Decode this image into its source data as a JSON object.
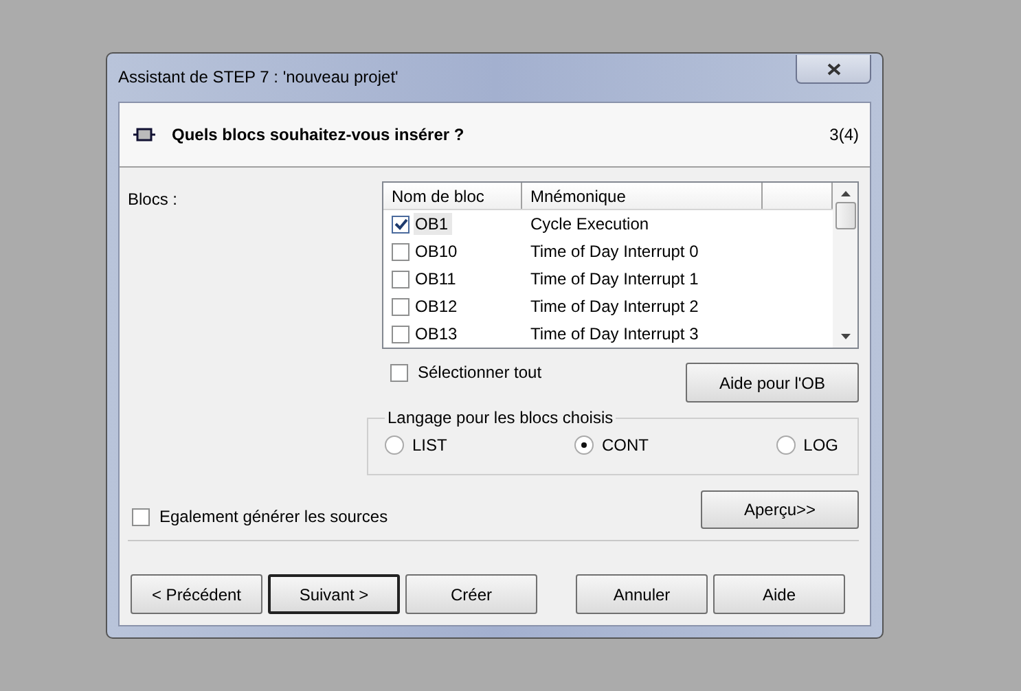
{
  "window": {
    "title": "Assistant de STEP 7 : 'nouveau projet'"
  },
  "header": {
    "question": "Quels blocs souhaitez-vous insérer ?",
    "step": "3(4)"
  },
  "blocks_label": "Blocs :",
  "table": {
    "columns": [
      "Nom de bloc",
      "Mnémonique"
    ],
    "rows": [
      {
        "name": "OB1",
        "mnemonic": "Cycle Execution",
        "checked": true
      },
      {
        "name": "OB10",
        "mnemonic": "Time of Day Interrupt 0",
        "checked": false
      },
      {
        "name": "OB11",
        "mnemonic": "Time of Day Interrupt 1",
        "checked": false
      },
      {
        "name": "OB12",
        "mnemonic": "Time of Day Interrupt 2",
        "checked": false
      },
      {
        "name": "OB13",
        "mnemonic": "Time of Day Interrupt 3",
        "checked": false
      }
    ]
  },
  "select_all": {
    "label": "Sélectionner tout",
    "checked": false
  },
  "ob_help_button": "Aide pour l'OB",
  "language_group": {
    "title": "Langage pour les blocs choisis",
    "options": [
      {
        "label": "LIST",
        "selected": false
      },
      {
        "label": "CONT",
        "selected": true
      },
      {
        "label": "LOG",
        "selected": false
      }
    ]
  },
  "generate_sources": {
    "label": "Egalement générer les sources",
    "checked": false
  },
  "preview_button": "Aperçu>>",
  "buttons": [
    {
      "label": "< Précédent",
      "default": false
    },
    {
      "label": "Suivant >",
      "default": true
    },
    {
      "label": "Créer",
      "default": false
    },
    {
      "label": "Annuler",
      "default": false
    },
    {
      "label": "Aide",
      "default": false
    }
  ]
}
